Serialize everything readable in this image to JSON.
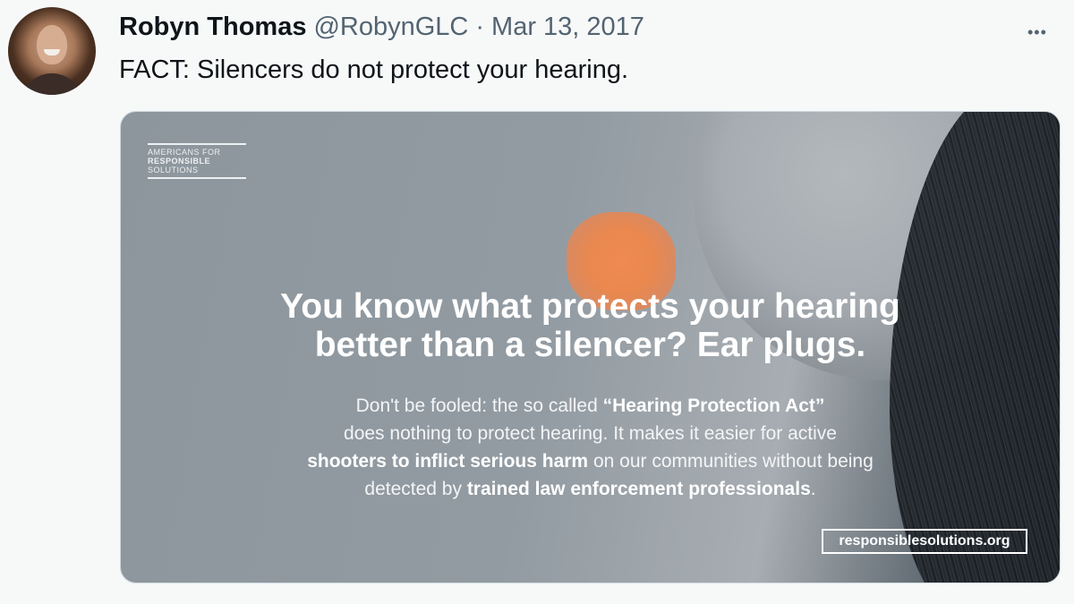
{
  "tweet": {
    "author_name": "Robyn Thomas",
    "handle": "@RobynGLC",
    "separator": "·",
    "date": "Mar 13, 2017",
    "more_icon": "more-horizontal-icon",
    "text": "FACT: Silencers do not protect your hearing."
  },
  "card": {
    "logo": {
      "line1": "AMERICANS FOR",
      "line2": "RESPONSIBLE",
      "line3": "SOLUTIONS"
    },
    "headline_line1": "You know what protects your hearing",
    "headline_line2": "better than a silencer? Ear plugs.",
    "body": {
      "l1_a": "Don't be fooled: the so called ",
      "l1_b": "“Hearing Protection Act”",
      "l2": "does nothing to protect hearing. It makes it easier for active",
      "l3_a": "shooters to inflict serious harm",
      "l3_b": " on our communities without being",
      "l4_a": "detected by ",
      "l4_b": "trained law enforcement professionals",
      "l4_c": "."
    },
    "url": "responsiblesolutions.org"
  }
}
